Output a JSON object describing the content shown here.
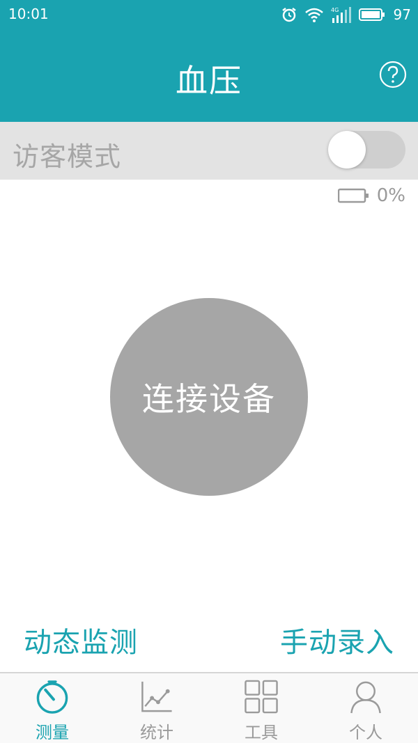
{
  "status_bar": {
    "time": "10:01",
    "battery": "97",
    "network": "4G"
  },
  "header": {
    "title": "血压"
  },
  "guest_mode": {
    "label": "访客模式",
    "enabled": false
  },
  "device": {
    "battery_percent": "0%"
  },
  "connect": {
    "label": "连接设备"
  },
  "links": {
    "dynamic_monitor": "动态监测",
    "manual_entry": "手动录入"
  },
  "nav": {
    "items": [
      {
        "label": "测量",
        "icon": "stopwatch-icon",
        "active": true
      },
      {
        "label": "统计",
        "icon": "line-chart-icon",
        "active": false
      },
      {
        "label": "工具",
        "icon": "grid-icon",
        "active": false
      },
      {
        "label": "个人",
        "icon": "person-icon",
        "active": false
      }
    ]
  },
  "colors": {
    "primary": "#1aa3b0",
    "muted": "#a6a6a6",
    "row_bg": "#e3e3e3"
  }
}
